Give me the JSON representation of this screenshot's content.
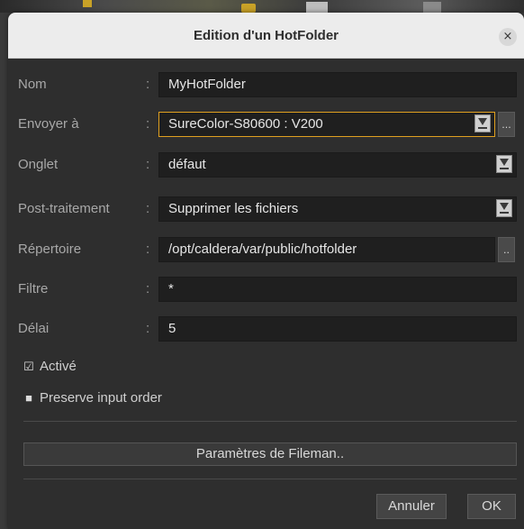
{
  "window": {
    "title": "Edition d'un HotFolder",
    "close_symbol": "×"
  },
  "form": {
    "colon": ":",
    "fields": {
      "nom": {
        "label": "Nom",
        "value": "MyHotFolder"
      },
      "envoyer": {
        "label": "Envoyer à",
        "value": "SureColor-S80600 : V200",
        "more": "..."
      },
      "onglet": {
        "label": "Onglet",
        "value": "défaut"
      },
      "post": {
        "label": "Post-traitement",
        "value": "Supprimer les fichiers"
      },
      "repertoire": {
        "label": "Répertoire",
        "value": "/opt/caldera/var/public/hotfolder",
        "more": ".."
      },
      "filtre": {
        "label": "Filtre",
        "value": "*"
      },
      "delai": {
        "label": "Délai",
        "value": "5"
      }
    },
    "checkboxes": {
      "active": {
        "label": "Activé",
        "checked": true,
        "mark": "☑"
      },
      "preserve": {
        "label": "Preserve input order",
        "checked": false,
        "mark": "■"
      }
    },
    "fileman_button": "Paramètres de Fileman.."
  },
  "buttons": {
    "cancel": "Annuler",
    "ok": "OK"
  },
  "colors": {
    "background": "#2e2e2e",
    "field": "#1f1f1f",
    "focus_accent": "#e0a020",
    "titlebar": "#ececec"
  },
  "icons": {
    "close": "close-icon",
    "dropdown": "chevron-down-icon"
  }
}
